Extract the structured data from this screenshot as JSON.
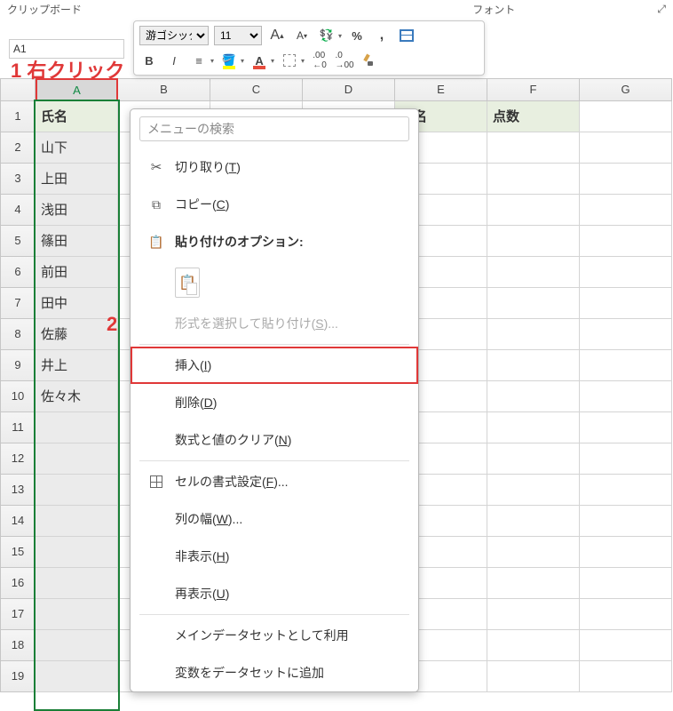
{
  "ribbon": {
    "left_group": "クリップボード",
    "right_group_partial": "フォント",
    "expand_mark": "⤢"
  },
  "name_box": "A1",
  "mini_toolbar": {
    "font_name": "游ゴシック",
    "font_size": "11",
    "increase_font_icon": "A",
    "decrease_font_icon": "A",
    "bold": "B",
    "italic": "I"
  },
  "annotations": {
    "one": "1 右クリック",
    "two": "2"
  },
  "columns": [
    "A",
    "B",
    "C",
    "D",
    "E",
    "F",
    "G"
  ],
  "col_widths": {
    "A": 93,
    "other": 104
  },
  "rows": [
    {
      "n": 1,
      "A": "氏名",
      "E": "氏名",
      "F": "点数",
      "is_header": true
    },
    {
      "n": 2,
      "A": "山下"
    },
    {
      "n": 3,
      "A": "上田"
    },
    {
      "n": 4,
      "A": "浅田"
    },
    {
      "n": 5,
      "A": "篠田"
    },
    {
      "n": 6,
      "A": "前田"
    },
    {
      "n": 7,
      "A": "田中"
    },
    {
      "n": 8,
      "A": "佐藤"
    },
    {
      "n": 9,
      "A": "井上"
    },
    {
      "n": 10,
      "A": "佐々木"
    },
    {
      "n": 11
    },
    {
      "n": 12
    },
    {
      "n": 13
    },
    {
      "n": 14
    },
    {
      "n": 15
    },
    {
      "n": 16
    },
    {
      "n": 17
    },
    {
      "n": 18
    },
    {
      "n": 19
    }
  ],
  "context_menu": {
    "search_placeholder": "メニューの検索",
    "items": [
      {
        "id": "cut",
        "icon": "scissors",
        "label": "切り取り(",
        "shortcut": "T",
        "suffix": ")"
      },
      {
        "id": "copy",
        "icon": "copy",
        "label": "コピー(",
        "shortcut": "C",
        "suffix": ")"
      },
      {
        "id": "paste_options",
        "icon": "paste",
        "label": "貼り付けのオプション:",
        "bold": true
      },
      {
        "id": "paste_chip",
        "sub": true
      },
      {
        "id": "paste_special",
        "label": "形式を選択して貼り付け(",
        "shortcut": "S",
        "suffix": ")...",
        "disabled": true
      },
      {
        "sep": true
      },
      {
        "id": "insert",
        "label": "挿入(",
        "shortcut": "I",
        "suffix": ")",
        "highlight": true
      },
      {
        "id": "delete",
        "label": "削除(",
        "shortcut": "D",
        "suffix": ")"
      },
      {
        "id": "clear",
        "label": "数式と値のクリア(",
        "shortcut": "N",
        "suffix": ")"
      },
      {
        "sep": true
      },
      {
        "id": "format_cells",
        "icon": "cells",
        "label": "セルの書式設定(",
        "shortcut": "F",
        "suffix": ")..."
      },
      {
        "id": "col_width",
        "label": "列の幅(",
        "shortcut": "W",
        "suffix": ")..."
      },
      {
        "id": "hide",
        "label": "非表示(",
        "shortcut": "H",
        "suffix": ")"
      },
      {
        "id": "unhide",
        "label": "再表示(",
        "shortcut": "U",
        "suffix": ")"
      },
      {
        "sep": true
      },
      {
        "id": "main_dataset",
        "label": "メインデータセットとして利用"
      },
      {
        "id": "add_var",
        "label": "変数をデータセットに追加"
      }
    ]
  }
}
